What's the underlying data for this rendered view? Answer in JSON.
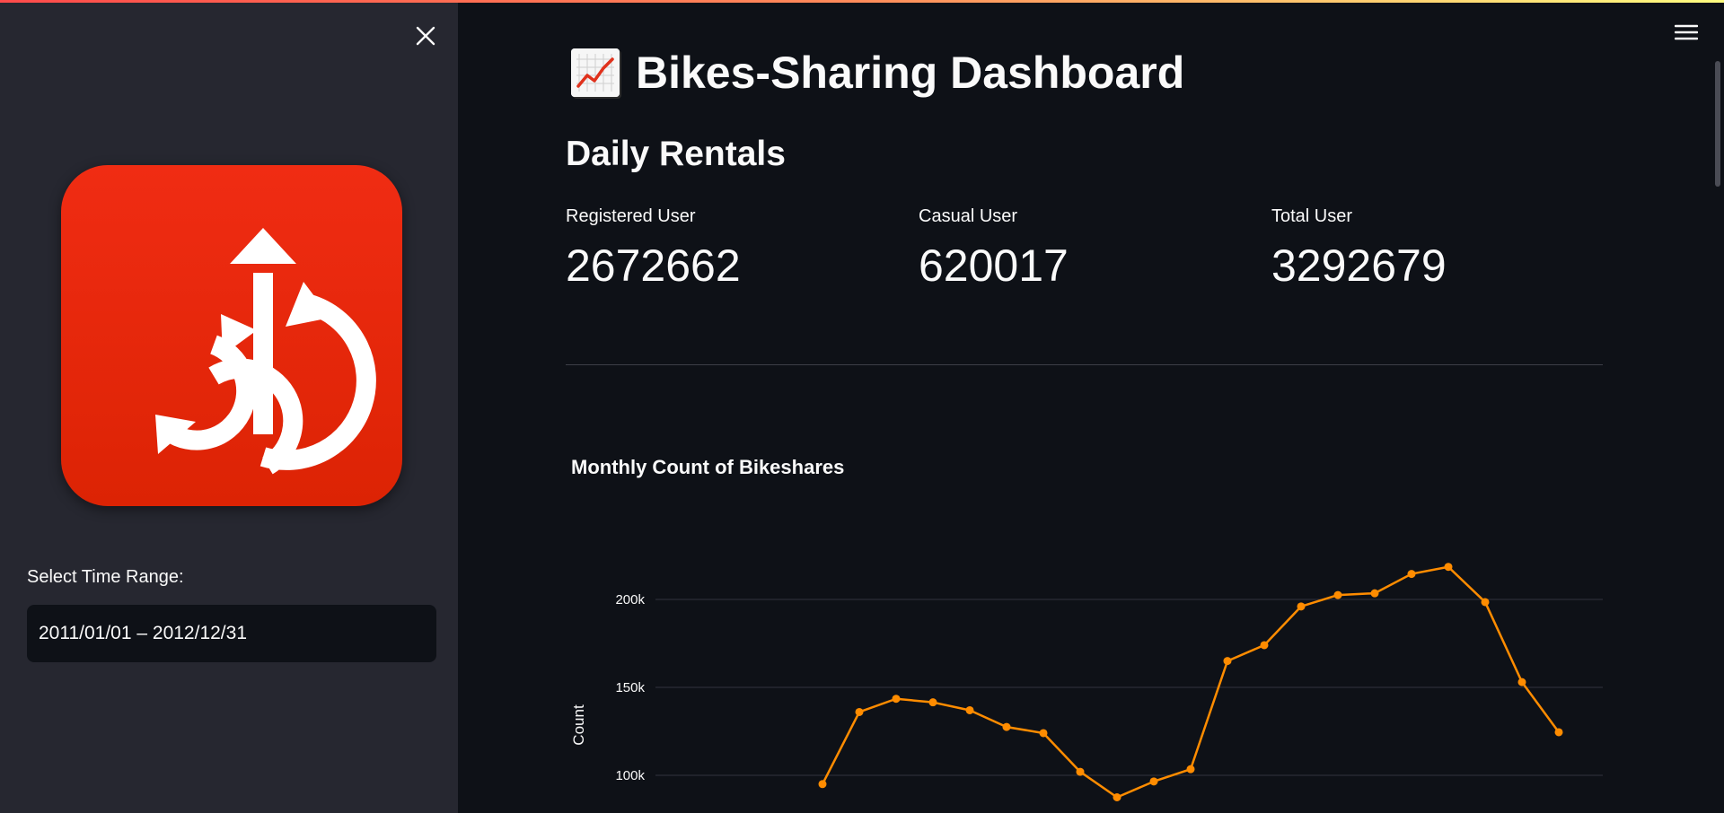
{
  "sidebar": {
    "range_label": "Select Time Range:",
    "range_value": "2011/01/01 – 2012/12/31",
    "close_icon": "close-icon",
    "logo_icon": "bike-sharing-logo"
  },
  "header": {
    "menu_icon": "hamburger-menu-icon",
    "title_icon": "chart-increasing-icon",
    "title": "Bikes-Sharing Dashboard"
  },
  "daily": {
    "heading": "Daily Rentals",
    "metrics": [
      {
        "label": "Registered User",
        "value": "2672662"
      },
      {
        "label": "Casual User",
        "value": "620017"
      },
      {
        "label": "Total User",
        "value": "3292679"
      }
    ]
  },
  "colors": {
    "accent": "#ff8c00",
    "sidebar_bg": "#262730",
    "main_bg": "#0e1117",
    "logo_red": "#e8280c"
  },
  "chart_data": {
    "type": "line",
    "title": "Monthly Count of Bikeshares",
    "xlabel": "",
    "ylabel": "Count",
    "y_ticks": [
      "100k",
      "150k",
      "200k"
    ],
    "grid": true,
    "series": [
      {
        "values": [
          null,
          null,
          null,
          null,
          null,
          null,
          95000,
          136000,
          143500,
          141500,
          137000,
          127500,
          124000,
          102000,
          87500,
          96500,
          103500,
          165000,
          174000,
          196000,
          202500,
          203500,
          214500,
          218500,
          198500,
          153000,
          124500
        ]
      }
    ]
  }
}
